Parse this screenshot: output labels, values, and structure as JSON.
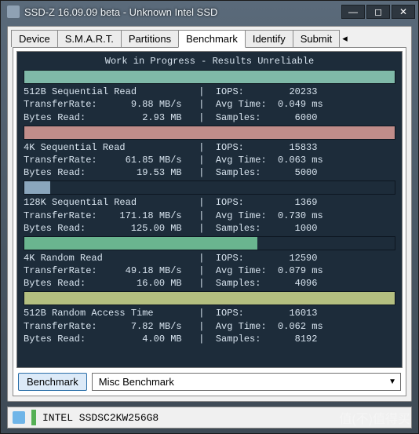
{
  "window": {
    "title": "SSD-Z 16.09.09 beta - Unknown Intel SSD"
  },
  "tabs": {
    "items": [
      "Device",
      "S.M.A.R.T.",
      "Partitions",
      "Benchmark",
      "Identify",
      "Submit"
    ],
    "active": 3
  },
  "benchmark": {
    "header": "Work in Progress - Results Unreliable",
    "button_label": "Benchmark",
    "select_value": "Misc Benchmark",
    "blocks": [
      {
        "name": "512B Sequential Read",
        "bar_color": "#7fb9a8",
        "bar_width_pct": 100,
        "transfer_rate": "9.88 MB/s",
        "bytes_read": "2.93 MB",
        "iops": "20233",
        "avg_time": "0.049 ms",
        "samples": "6000"
      },
      {
        "name": "4K Sequential Read",
        "bar_color": "#c08d8a",
        "bar_width_pct": 100,
        "transfer_rate": "61.85 MB/s",
        "bytes_read": "19.53 MB",
        "iops": "15833",
        "avg_time": "0.063 ms",
        "samples": "5000"
      },
      {
        "name": "128K Sequential Read",
        "bar_color": "#8aa6bd",
        "bar_width_pct": 7,
        "transfer_rate": "171.18 MB/s",
        "bytes_read": "125.00 MB",
        "iops": "1369",
        "avg_time": "0.730 ms",
        "samples": "1000"
      },
      {
        "name": "4K Random Read",
        "bar_color": "#6ab58f",
        "bar_width_pct": 63,
        "transfer_rate": "49.18 MB/s",
        "bytes_read": "16.00 MB",
        "iops": "12590",
        "avg_time": "0.079 ms",
        "samples": "4096"
      },
      {
        "name": "512B Random Access Time",
        "bar_color": "#b4bf80",
        "bar_width_pct": 100,
        "transfer_rate": "7.82 MB/s",
        "bytes_read": "4.00 MB",
        "iops": "16013",
        "avg_time": "0.062 ms",
        "samples": "8192"
      }
    ]
  },
  "status": {
    "device": "INTEL SSDSC2KW256G8"
  },
  "watermark": "值(不)值得买"
}
